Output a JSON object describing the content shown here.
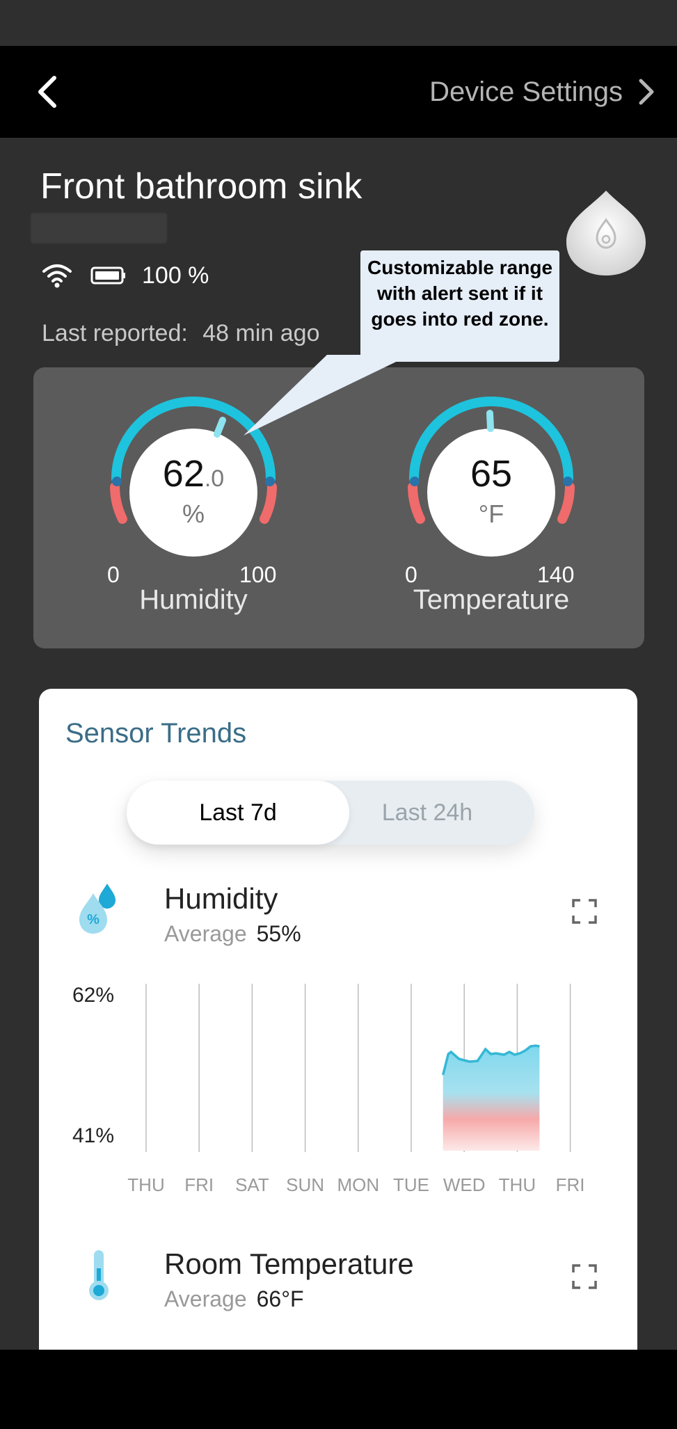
{
  "nav": {
    "back_icon": "chevron-left-icon",
    "settings_label": "Device Settings",
    "settings_icon": "chevron-right-icon"
  },
  "device": {
    "title": "Front bathroom sink",
    "battery": "100 %",
    "last_reported_label": "Last reported:",
    "last_reported_value": "48 min ago",
    "icon": "water-sensor-icon"
  },
  "callout": {
    "text": "Customizable range with alert sent if it goes into red zone."
  },
  "gauges": {
    "humidity": {
      "value_main": "62",
      "value_dec": ".0",
      "unit": "%",
      "min": "0",
      "max": "100",
      "label": "Humidity",
      "value": 62.0
    },
    "temperature": {
      "value_main": "65",
      "unit": "°F",
      "min": "0",
      "max": "140",
      "label": "Temperature",
      "value": 65
    }
  },
  "colors": {
    "gauge_blue": "#1ec3dd",
    "gauge_red": "#f06b6b",
    "title_blue": "#3a6d87"
  },
  "trends": {
    "title": "Sensor Trends",
    "tabs": [
      {
        "label": "Last 7d",
        "active": true
      },
      {
        "label": "Last 24h",
        "active": false
      }
    ],
    "humidity": {
      "name": "Humidity",
      "avg_label": "Average",
      "avg_value": "55%",
      "icon": "humidity-drop-icon"
    },
    "temperature": {
      "name": "Room Temperature",
      "avg_label": "Average",
      "avg_value": "66°F",
      "icon": "thermometer-icon"
    }
  },
  "chart_data": {
    "type": "area",
    "title": "",
    "ylabel": "",
    "y_tick_labels": [
      "62%",
      "41%"
    ],
    "ylim": [
      41,
      62
    ],
    "categories": [
      "THU",
      "FRI",
      "SAT",
      "SUN",
      "MON",
      "TUE",
      "WED",
      "THU",
      "FRI"
    ],
    "series": [
      {
        "x": [
          5.6,
          5.7,
          5.75,
          5.9,
          6.0,
          6.1,
          6.25,
          6.4,
          6.5,
          6.6,
          6.75,
          6.85,
          6.95,
          7.05,
          7.15,
          7.25,
          7.35,
          7.42
        ],
        "values": [
          50.5,
          53.5,
          53.8,
          52.8,
          52.6,
          52.4,
          52.5,
          54.2,
          53.5,
          53.6,
          53.4,
          53.8,
          53.4,
          53.6,
          54.0,
          54.6,
          54.7,
          54.6
        ]
      }
    ]
  }
}
